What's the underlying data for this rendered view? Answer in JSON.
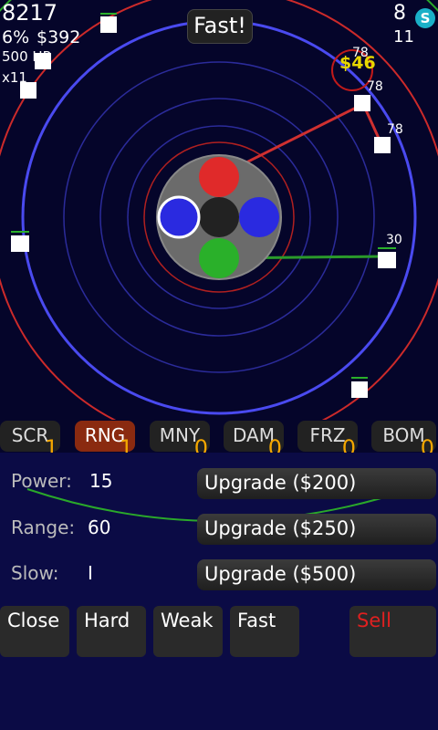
{
  "hud": {
    "score": "8217",
    "percent": "6%",
    "money": "$392",
    "hp": "500 HP",
    "multiplier": "x11",
    "lives": "8",
    "wave": "11",
    "speed_button": "Fast!",
    "coin_icon_letter": "S"
  },
  "field": {
    "floating_text": "$46",
    "enemy_labels": [
      "78",
      "78",
      "78",
      "30"
    ]
  },
  "tabs": [
    {
      "label": "SCR",
      "level": "1"
    },
    {
      "label": "RNG",
      "level": "1",
      "active": true
    },
    {
      "label": "MNY",
      "level": "0"
    },
    {
      "label": "DAM",
      "level": "0"
    },
    {
      "label": "FRZ",
      "level": "0"
    },
    {
      "label": "BOM",
      "level": "0"
    }
  ],
  "stats": {
    "power_label": "Power:",
    "power_value": "15",
    "range_label": "Range:",
    "range_value": "60",
    "slow_label": "Slow:",
    "slow_value": "I"
  },
  "upgrades": {
    "power": "Upgrade ($200)",
    "range": "Upgrade ($250)",
    "slow": "Upgrade ($500)"
  },
  "actions": {
    "close": "Close",
    "hard": "Hard",
    "weak": "Weak",
    "fast": "Fast",
    "sell": "Sell"
  },
  "colors": {
    "background": "#05052a",
    "panel": "#0b0b45",
    "orbit_blue": "#4a4af0",
    "orbit_red": "#cc2a2a",
    "orbit_green": "#2aa82a",
    "level_number": "#f3a600",
    "sell_text": "#e02020",
    "active_tab": "#8a2a10"
  }
}
